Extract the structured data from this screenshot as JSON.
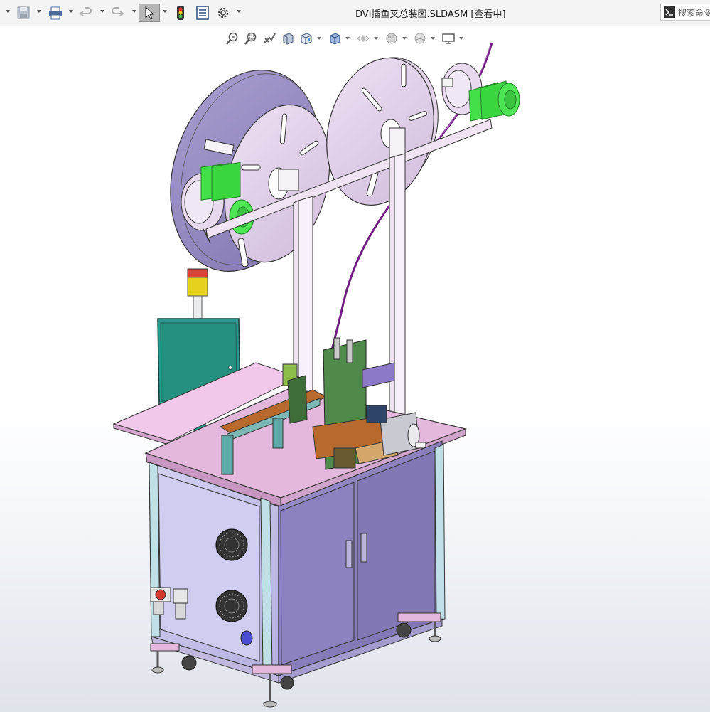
{
  "window": {
    "title": "DVI插鱼叉总装图.SLDASM [查看中]"
  },
  "toolbar": {
    "buttons": [
      {
        "name": "new-dropdown",
        "icon": "chevron-down-icon"
      },
      {
        "name": "save",
        "icon": "save-icon"
      },
      {
        "name": "print",
        "icon": "print-icon"
      },
      {
        "name": "undo",
        "icon": "undo-icon"
      },
      {
        "name": "redo",
        "icon": "redo-icon"
      },
      {
        "name": "select",
        "icon": "select-cursor-icon"
      },
      {
        "name": "rebuild",
        "icon": "traffic-light-icon"
      },
      {
        "name": "file-properties",
        "icon": "file-properties-icon"
      },
      {
        "name": "options",
        "icon": "gear-icon"
      }
    ]
  },
  "search": {
    "icon": "command-prompt-icon",
    "label": "搜索命令"
  },
  "headsup": {
    "tools": [
      "zoom-to-fit-icon",
      "zoom-to-area-icon",
      "previous-view-icon",
      "section-view-icon",
      "view-orientation-icon",
      "display-style-icon",
      "hide-show-items-icon",
      "edit-appearance-icon",
      "apply-scene-icon",
      "view-settings-icon"
    ]
  },
  "colors": {
    "reel": "#dcc8e3",
    "reel_back": "#9c8fc0",
    "frame": "#f0e4f2",
    "motor": "#44e04a",
    "table_top": "#e3b8dc",
    "cabinet_side": "#bfbde6",
    "cabinet_door": "#8a7fba",
    "electric_box": "#2a9a8e",
    "wire": "#7d1e8c"
  }
}
